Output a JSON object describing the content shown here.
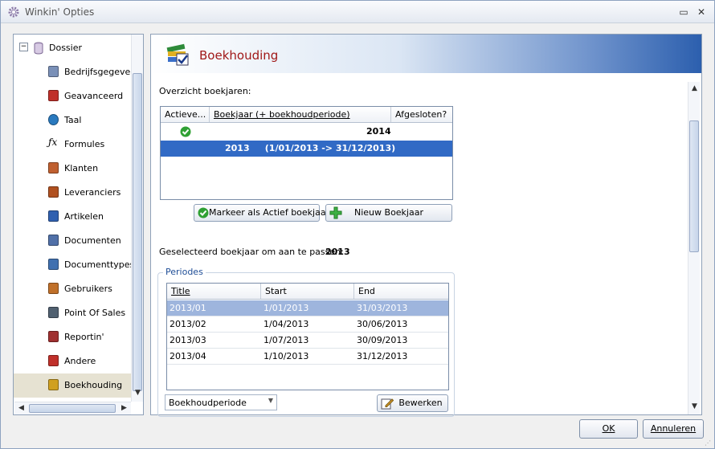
{
  "window": {
    "title": "Winkin' Opties",
    "minimize": "▭",
    "close": "✕"
  },
  "tree": {
    "root": {
      "label": "Dossier",
      "expander": "⊟"
    },
    "items": [
      {
        "label": "Bedrijfsgegevens",
        "icon": "building-icon"
      },
      {
        "label": "Geavanceerd",
        "icon": "checklist-icon"
      },
      {
        "label": "Taal",
        "icon": "globe-icon"
      },
      {
        "label": "Formules",
        "icon": "function-icon",
        "glyph": "ƒx"
      },
      {
        "label": "Klanten",
        "icon": "customer-icon"
      },
      {
        "label": "Leveranciers",
        "icon": "truck-icon"
      },
      {
        "label": "Artikelen",
        "icon": "articles-icon"
      },
      {
        "label": "Documenten",
        "icon": "documents-icon"
      },
      {
        "label": "Documenttypes",
        "icon": "document-types-icon"
      },
      {
        "label": "Gebruikers",
        "icon": "users-icon"
      },
      {
        "label": "Point Of Sales",
        "icon": "cash-register-icon"
      },
      {
        "label": "Reportin'",
        "icon": "report-icon"
      },
      {
        "label": "Andere",
        "icon": "checklist-icon"
      },
      {
        "label": "Boekhouding",
        "icon": "books-icon"
      }
    ],
    "selected_index": 13
  },
  "header": {
    "title": "Boekhouding"
  },
  "overzicht": {
    "label": "Overzicht boekjaren:",
    "columns": [
      "Actieve...",
      "Boekjaar (+ boekhoudperiode)",
      "Afgesloten?"
    ],
    "rows": [
      {
        "active": true,
        "boekjaar": "2014",
        "afgesloten": ""
      },
      {
        "active": false,
        "boekjaar": "2013     (1/01/2013 -> 31/12/2013)",
        "afgesloten": ""
      }
    ],
    "selected_row": 1
  },
  "buttons": {
    "markeer": "Markeer als Actief boekjaar",
    "nieuw": "Nieuw Boekjaar"
  },
  "geselecteerd": {
    "label": "Geselecteerd boekjaar om aan te passen:",
    "value": "2013"
  },
  "periodes": {
    "title": "Periodes",
    "columns": [
      "Title",
      "Start",
      "End"
    ],
    "rows": [
      [
        "2013/01",
        "1/01/2013",
        "31/03/2013"
      ],
      [
        "2013/02",
        "1/04/2013",
        "30/06/2013"
      ],
      [
        "2013/03",
        "1/07/2013",
        "30/09/2013"
      ],
      [
        "2013/04",
        "1/10/2013",
        "31/12/2013"
      ]
    ],
    "selected_row": 0,
    "combo_value": "Boekhoudperiode",
    "bewerken": "Bewerken"
  },
  "footer": {
    "ok": "OK",
    "annuleren": "Annuleren"
  },
  "colors": {
    "selection": "#316ac5",
    "period_selection": "#9eb5dd",
    "header_title": "#a01818",
    "group_title": "#1e4d96"
  }
}
